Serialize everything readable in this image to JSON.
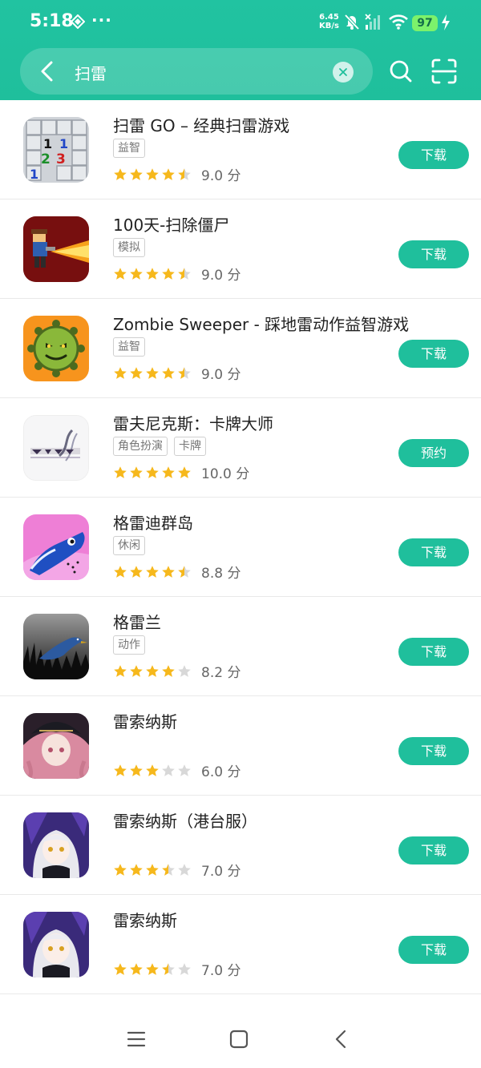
{
  "status": {
    "time": "5:18",
    "more": "···",
    "net_speed": "6.45",
    "net_unit": "KB/s",
    "battery": "97"
  },
  "search": {
    "query": "扫雷",
    "placeholder": "扫雷"
  },
  "apps": [
    {
      "name": "扫雷 GO – 经典扫雷游戏",
      "tags": [
        "益智"
      ],
      "stars": 4.5,
      "score": "9.0 分",
      "button": "下载"
    },
    {
      "name": "100天-扫除僵尸",
      "tags": [
        "模拟"
      ],
      "stars": 4.5,
      "score": "9.0 分",
      "button": "下载"
    },
    {
      "name": "Zombie Sweeper - 踩地雷动作益智游戏",
      "tags": [
        "益智"
      ],
      "stars": 4.5,
      "score": "9.0 分",
      "button": "下载"
    },
    {
      "name": "雷夫尼克斯：卡牌大师",
      "tags": [
        "角色扮演",
        "卡牌"
      ],
      "stars": 5,
      "score": "10.0 分",
      "button": "预约"
    },
    {
      "name": "格雷迪群岛",
      "tags": [
        "休闲"
      ],
      "stars": 4.5,
      "score": "8.8 分",
      "button": "下载"
    },
    {
      "name": "格雷兰",
      "tags": [
        "动作"
      ],
      "stars": 4,
      "score": "8.2 分",
      "button": "下载"
    },
    {
      "name": "雷索纳斯",
      "tags": [],
      "stars": 3,
      "score": "6.0 分",
      "button": "下载"
    },
    {
      "name": "雷索纳斯（港台服）",
      "tags": [],
      "stars": 3.5,
      "score": "7.0 分",
      "button": "下载"
    },
    {
      "name": "雷索纳斯",
      "tags": [],
      "stars": 3.5,
      "score": "7.0 分",
      "button": "下载"
    }
  ],
  "icons": {
    "back": "chevron-left-icon",
    "search": "search-icon",
    "scan": "scan-icon",
    "clear": "close-icon",
    "menu": "menu-icon",
    "home": "home-icon",
    "nav_back": "back-icon"
  },
  "colors": {
    "accent": "#1fbf9c",
    "star": "#f6b81c",
    "star_empty": "#d8d8d8"
  }
}
